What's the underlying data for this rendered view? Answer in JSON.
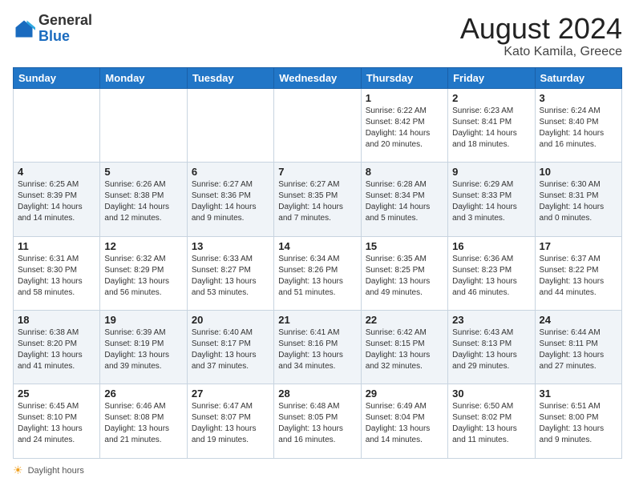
{
  "logo": {
    "general": "General",
    "blue": "Blue"
  },
  "header": {
    "title": "August 2024",
    "subtitle": "Kato Kamila, Greece"
  },
  "weekdays": [
    "Sunday",
    "Monday",
    "Tuesday",
    "Wednesday",
    "Thursday",
    "Friday",
    "Saturday"
  ],
  "footer": {
    "note": "Daylight hours"
  },
  "weeks": [
    [
      {
        "day": "",
        "info": ""
      },
      {
        "day": "",
        "info": ""
      },
      {
        "day": "",
        "info": ""
      },
      {
        "day": "",
        "info": ""
      },
      {
        "day": "1",
        "info": "Sunrise: 6:22 AM\nSunset: 8:42 PM\nDaylight: 14 hours\nand 20 minutes."
      },
      {
        "day": "2",
        "info": "Sunrise: 6:23 AM\nSunset: 8:41 PM\nDaylight: 14 hours\nand 18 minutes."
      },
      {
        "day": "3",
        "info": "Sunrise: 6:24 AM\nSunset: 8:40 PM\nDaylight: 14 hours\nand 16 minutes."
      }
    ],
    [
      {
        "day": "4",
        "info": "Sunrise: 6:25 AM\nSunset: 8:39 PM\nDaylight: 14 hours\nand 14 minutes."
      },
      {
        "day": "5",
        "info": "Sunrise: 6:26 AM\nSunset: 8:38 PM\nDaylight: 14 hours\nand 12 minutes."
      },
      {
        "day": "6",
        "info": "Sunrise: 6:27 AM\nSunset: 8:36 PM\nDaylight: 14 hours\nand 9 minutes."
      },
      {
        "day": "7",
        "info": "Sunrise: 6:27 AM\nSunset: 8:35 PM\nDaylight: 14 hours\nand 7 minutes."
      },
      {
        "day": "8",
        "info": "Sunrise: 6:28 AM\nSunset: 8:34 PM\nDaylight: 14 hours\nand 5 minutes."
      },
      {
        "day": "9",
        "info": "Sunrise: 6:29 AM\nSunset: 8:33 PM\nDaylight: 14 hours\nand 3 minutes."
      },
      {
        "day": "10",
        "info": "Sunrise: 6:30 AM\nSunset: 8:31 PM\nDaylight: 14 hours\nand 0 minutes."
      }
    ],
    [
      {
        "day": "11",
        "info": "Sunrise: 6:31 AM\nSunset: 8:30 PM\nDaylight: 13 hours\nand 58 minutes."
      },
      {
        "day": "12",
        "info": "Sunrise: 6:32 AM\nSunset: 8:29 PM\nDaylight: 13 hours\nand 56 minutes."
      },
      {
        "day": "13",
        "info": "Sunrise: 6:33 AM\nSunset: 8:27 PM\nDaylight: 13 hours\nand 53 minutes."
      },
      {
        "day": "14",
        "info": "Sunrise: 6:34 AM\nSunset: 8:26 PM\nDaylight: 13 hours\nand 51 minutes."
      },
      {
        "day": "15",
        "info": "Sunrise: 6:35 AM\nSunset: 8:25 PM\nDaylight: 13 hours\nand 49 minutes."
      },
      {
        "day": "16",
        "info": "Sunrise: 6:36 AM\nSunset: 8:23 PM\nDaylight: 13 hours\nand 46 minutes."
      },
      {
        "day": "17",
        "info": "Sunrise: 6:37 AM\nSunset: 8:22 PM\nDaylight: 13 hours\nand 44 minutes."
      }
    ],
    [
      {
        "day": "18",
        "info": "Sunrise: 6:38 AM\nSunset: 8:20 PM\nDaylight: 13 hours\nand 41 minutes."
      },
      {
        "day": "19",
        "info": "Sunrise: 6:39 AM\nSunset: 8:19 PM\nDaylight: 13 hours\nand 39 minutes."
      },
      {
        "day": "20",
        "info": "Sunrise: 6:40 AM\nSunset: 8:17 PM\nDaylight: 13 hours\nand 37 minutes."
      },
      {
        "day": "21",
        "info": "Sunrise: 6:41 AM\nSunset: 8:16 PM\nDaylight: 13 hours\nand 34 minutes."
      },
      {
        "day": "22",
        "info": "Sunrise: 6:42 AM\nSunset: 8:15 PM\nDaylight: 13 hours\nand 32 minutes."
      },
      {
        "day": "23",
        "info": "Sunrise: 6:43 AM\nSunset: 8:13 PM\nDaylight: 13 hours\nand 29 minutes."
      },
      {
        "day": "24",
        "info": "Sunrise: 6:44 AM\nSunset: 8:11 PM\nDaylight: 13 hours\nand 27 minutes."
      }
    ],
    [
      {
        "day": "25",
        "info": "Sunrise: 6:45 AM\nSunset: 8:10 PM\nDaylight: 13 hours\nand 24 minutes."
      },
      {
        "day": "26",
        "info": "Sunrise: 6:46 AM\nSunset: 8:08 PM\nDaylight: 13 hours\nand 21 minutes."
      },
      {
        "day": "27",
        "info": "Sunrise: 6:47 AM\nSunset: 8:07 PM\nDaylight: 13 hours\nand 19 minutes."
      },
      {
        "day": "28",
        "info": "Sunrise: 6:48 AM\nSunset: 8:05 PM\nDaylight: 13 hours\nand 16 minutes."
      },
      {
        "day": "29",
        "info": "Sunrise: 6:49 AM\nSunset: 8:04 PM\nDaylight: 13 hours\nand 14 minutes."
      },
      {
        "day": "30",
        "info": "Sunrise: 6:50 AM\nSunset: 8:02 PM\nDaylight: 13 hours\nand 11 minutes."
      },
      {
        "day": "31",
        "info": "Sunrise: 6:51 AM\nSunset: 8:00 PM\nDaylight: 13 hours\nand 9 minutes."
      }
    ]
  ]
}
